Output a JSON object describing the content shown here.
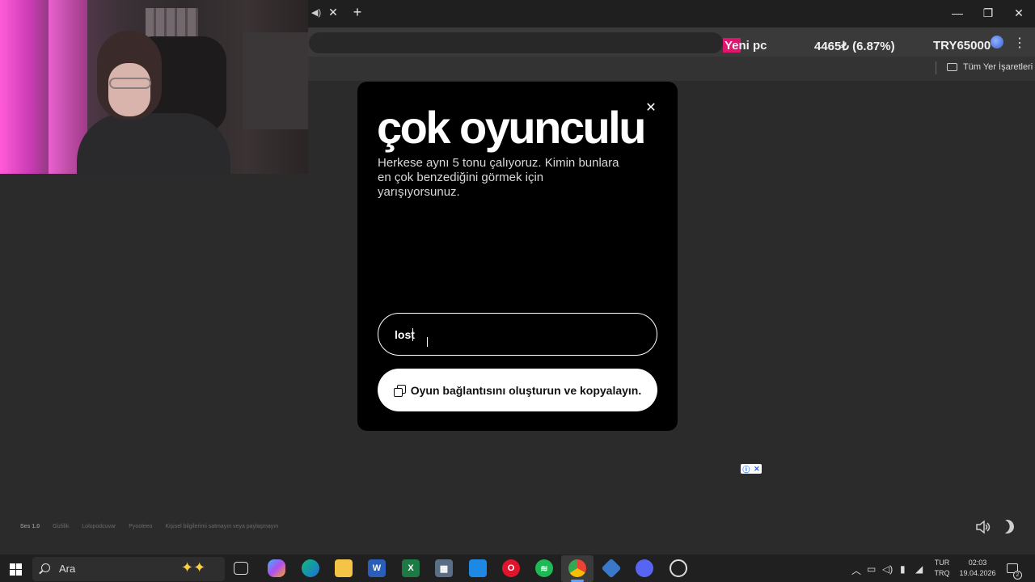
{
  "browser": {
    "bookmarks_label": "Tüm Yer İşaretleri"
  },
  "stream_overlay": {
    "goal_label": "Yeni pc",
    "progress_text": "4465₺ (6.87%)",
    "goal_amount": "TRY65000",
    "progress_fraction": 0.0687
  },
  "modal": {
    "title": "çok oyunculu",
    "description": "Herkese aynı 5 tonu çalıyoruz. Kimin bunlara en çok benzediğini görmek için yarışıyorsunuz.",
    "name_value": "lost",
    "create_button_label": "Oyun bağlantısını oluşturun ve kopyalayın.",
    "close_icon": "close-icon"
  },
  "footer": {
    "version": "Ses 1.0",
    "links": [
      "Gizlilik",
      "Lolopodcuvar",
      "Pyooleeo",
      "Kişisel bilgilerimi satmayın veya paylaşmayın"
    ]
  },
  "taskbar": {
    "search_label": "Ara",
    "apps": [
      "task-view",
      "copilot",
      "edge",
      "file-explorer",
      "word",
      "excel",
      "calculator",
      "app-blue",
      "opera",
      "spotify",
      "chrome",
      "app-snip",
      "discord",
      "app-record"
    ],
    "language_top": "TUR",
    "language_bottom": "TRQ",
    "time": "02:03",
    "date": "19.04.2026",
    "notification_count": "2"
  },
  "colors": {
    "page_bg": "#2b2b2b",
    "modal_bg": "#000000",
    "button_bg": "#ffffff",
    "overlay_accent": "#e0136f"
  }
}
